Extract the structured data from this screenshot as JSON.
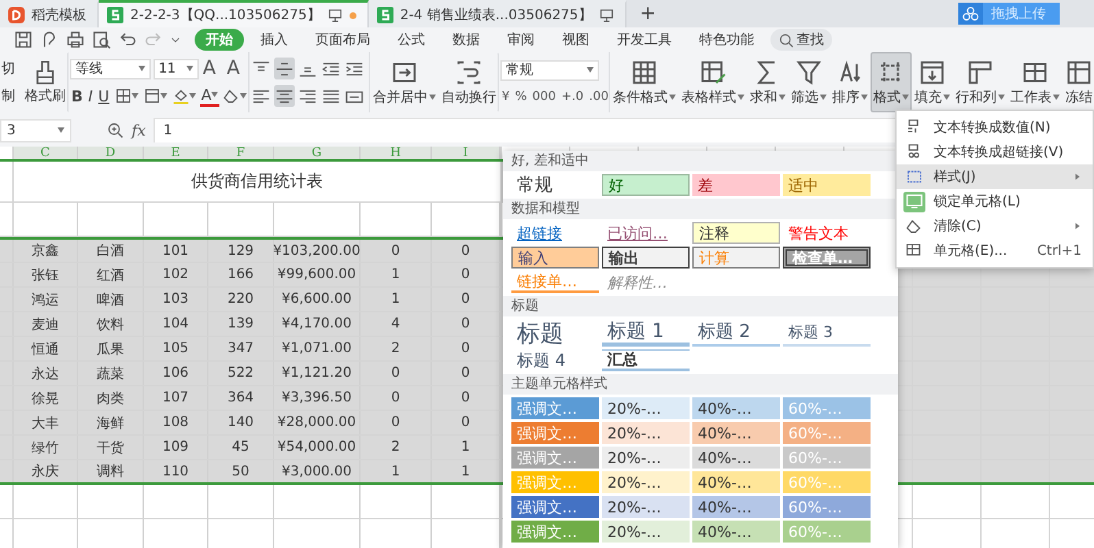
{
  "tabs": [
    {
      "label": "稻壳模板",
      "kind": "docer",
      "selected": false,
      "unsaved": false
    },
    {
      "label": "2-2-2-3【QQ...103506275】",
      "kind": "sheet",
      "selected": true,
      "unsaved": true
    },
    {
      "label": "2-4 销售业绩表...03506275】",
      "kind": "sheet",
      "selected": false,
      "unsaved": false
    }
  ],
  "new_tab": "+",
  "upload_button": "拖拽上传",
  "menu": [
    {
      "label": "开始",
      "selected": true
    },
    {
      "label": "插入",
      "selected": false
    },
    {
      "label": "页面布局",
      "selected": false
    },
    {
      "label": "公式",
      "selected": false
    },
    {
      "label": "数据",
      "selected": false
    },
    {
      "label": "审阅",
      "selected": false
    },
    {
      "label": "视图",
      "selected": false
    },
    {
      "label": "开发工具",
      "selected": false
    },
    {
      "label": "特色功能",
      "selected": false
    }
  ],
  "search_button": "查找",
  "ribbon": {
    "clipboard": {
      "cut": "切",
      "copy": "制",
      "format_painter": "格式刷"
    },
    "font": {
      "name": "等线",
      "size": "11",
      "grow": "A",
      "shrink": "A",
      "bold": "B",
      "italic": "I",
      "underline": "U",
      "font_color": "A"
    },
    "align_buttons": [
      {
        "kind": "top",
        "selected": false
      },
      {
        "kind": "middle",
        "selected": true
      },
      {
        "kind": "bottom",
        "selected": false
      },
      {
        "kind": "outdent",
        "selected": false
      },
      {
        "kind": "indent",
        "selected": false
      },
      {
        "kind": "left",
        "selected": false
      },
      {
        "kind": "center",
        "selected": true
      },
      {
        "kind": "right",
        "selected": false
      },
      {
        "kind": "justify",
        "selected": false
      },
      {
        "kind": "distributed",
        "selected": false
      }
    ],
    "merge": "合并居中",
    "wrap": "自动换行",
    "number_format": "常规",
    "number_buttons": [
      "¥",
      "%",
      "000",
      "+.0",
      ".00"
    ],
    "tools": [
      {
        "label": "条件格式",
        "kind": "conditional",
        "dropdown": true,
        "selected": false
      },
      {
        "label": "表格样式",
        "kind": "table",
        "dropdown": true,
        "selected": false
      },
      {
        "label": "求和",
        "kind": "sum",
        "dropdown": true,
        "selected": false
      },
      {
        "label": "筛选",
        "kind": "filter",
        "dropdown": true,
        "selected": false
      },
      {
        "label": "排序",
        "kind": "sort",
        "dropdown": true,
        "selected": false
      },
      {
        "label": "格式",
        "kind": "format",
        "dropdown": true,
        "selected": true
      },
      {
        "label": "填充",
        "kind": "fill",
        "dropdown": true,
        "selected": false
      },
      {
        "label": "行和列",
        "kind": "rowcol",
        "dropdown": true,
        "selected": false
      },
      {
        "label": "工作表",
        "kind": "sheet",
        "dropdown": true,
        "selected": false
      },
      {
        "label": "冻结",
        "kind": "freeze",
        "dropdown": false,
        "selected": false
      }
    ]
  },
  "formula_bar": {
    "cell": "3",
    "fx": "fx",
    "value": "1"
  },
  "sheet": {
    "columns": [
      {
        "label": "C",
        "selected": true
      },
      {
        "label": "D",
        "selected": true
      },
      {
        "label": "E",
        "selected": true
      },
      {
        "label": "F",
        "selected": true
      },
      {
        "label": "G",
        "selected": true
      },
      {
        "label": "H",
        "selected": true
      },
      {
        "label": "I",
        "selected": true
      }
    ],
    "title": "供货商信用统计表",
    "rows": [
      {
        "selected": true,
        "cells": [
          "京鑫",
          "白酒",
          "101",
          "129",
          "¥103,200.00",
          "0",
          "0"
        ]
      },
      {
        "selected": true,
        "cells": [
          "张钰",
          "红酒",
          "102",
          "166",
          "¥99,600.00",
          "1",
          "0"
        ]
      },
      {
        "selected": true,
        "cells": [
          "鸿运",
          "啤酒",
          "103",
          "220",
          "¥6,600.00",
          "1",
          "0"
        ]
      },
      {
        "selected": true,
        "cells": [
          "麦迪",
          "饮料",
          "104",
          "139",
          "¥4,170.00",
          "4",
          "0"
        ]
      },
      {
        "selected": true,
        "cells": [
          "恒通",
          "瓜果",
          "105",
          "347",
          "¥1,071.00",
          "2",
          "0"
        ]
      },
      {
        "selected": true,
        "cells": [
          "永达",
          "蔬菜",
          "106",
          "522",
          "¥1,121.20",
          "0",
          "0"
        ]
      },
      {
        "selected": true,
        "cells": [
          "徐晃",
          "肉类",
          "107",
          "364",
          "¥3,396.50",
          "0",
          "0"
        ]
      },
      {
        "selected": true,
        "cells": [
          "大丰",
          "海鲜",
          "108",
          "140",
          "¥28,000.00",
          "0",
          "0"
        ]
      },
      {
        "selected": true,
        "cells": [
          "绿竹",
          "干货",
          "109",
          "45",
          "¥54,000.00",
          "2",
          "1"
        ]
      },
      {
        "selected": true,
        "cells": [
          "永庆",
          "调料",
          "110",
          "50",
          "¥3,000.00",
          "1",
          "1"
        ]
      }
    ]
  },
  "style_gallery": {
    "sections": [
      {
        "title": "好, 差和适中",
        "items": [
          {
            "label": "常规",
            "kind": "normal"
          },
          {
            "label": "好",
            "kind": "good"
          },
          {
            "label": "差",
            "kind": "bad"
          },
          {
            "label": "适中",
            "kind": "neutral"
          }
        ]
      },
      {
        "title": "数据和模型",
        "items": [
          {
            "label": "超链接",
            "kind": "hyperlink"
          },
          {
            "label": "已访问…",
            "kind": "visited"
          },
          {
            "label": "注释",
            "kind": "note"
          },
          {
            "label": "警告文本",
            "kind": "warning"
          },
          {
            "label": "输入",
            "kind": "input"
          },
          {
            "label": "输出",
            "kind": "output"
          },
          {
            "label": "计算",
            "kind": "calc"
          },
          {
            "label": "检查单…",
            "kind": "check"
          },
          {
            "label": "链接单…",
            "kind": "linked"
          },
          {
            "label": "解释性…",
            "kind": "explanatory"
          }
        ]
      },
      {
        "title": "标题",
        "items": [
          {
            "label": "标题",
            "kind": "title"
          },
          {
            "label": "标题 1",
            "kind": "h1"
          },
          {
            "label": "标题 2",
            "kind": "h2"
          },
          {
            "label": "标题 3",
            "kind": "h3"
          },
          {
            "label": "标题 4",
            "kind": "h4"
          },
          {
            "label": "汇总",
            "kind": "total"
          }
        ]
      },
      {
        "title": "主题单元格样式",
        "items": [
          {
            "label": "强调文…",
            "kind": "accent",
            "color": "#5b9bd5"
          },
          {
            "label": "20%-…",
            "kind": "tint",
            "color": "#ddebf7"
          },
          {
            "label": "40%-…",
            "kind": "tint",
            "color": "#bdd7ee"
          },
          {
            "label": "60%-…",
            "kind": "accent",
            "color": "#9bc2e6"
          },
          {
            "label": "强调文…",
            "kind": "accent",
            "color": "#ed7d31"
          },
          {
            "label": "20%-…",
            "kind": "tint",
            "color": "#fce4d6"
          },
          {
            "label": "40%-…",
            "kind": "tint",
            "color": "#f8cbad"
          },
          {
            "label": "60%-…",
            "kind": "accent",
            "color": "#f4b084"
          },
          {
            "label": "强调文…",
            "kind": "accent",
            "color": "#a5a5a5"
          },
          {
            "label": "20%-…",
            "kind": "tint",
            "color": "#ededed"
          },
          {
            "label": "40%-…",
            "kind": "tint",
            "color": "#dbdbdb"
          },
          {
            "label": "60%-…",
            "kind": "accent",
            "color": "#c9c9c9"
          },
          {
            "label": "强调文…",
            "kind": "accent",
            "color": "#ffc000"
          },
          {
            "label": "20%-…",
            "kind": "tint",
            "color": "#fff2cc"
          },
          {
            "label": "40%-…",
            "kind": "tint",
            "color": "#ffe699"
          },
          {
            "label": "60%-…",
            "kind": "accent",
            "color": "#ffd966"
          },
          {
            "label": "强调文…",
            "kind": "accent",
            "color": "#4472c4"
          },
          {
            "label": "20%-…",
            "kind": "tint",
            "color": "#d9e1f2"
          },
          {
            "label": "40%-…",
            "kind": "tint",
            "color": "#b4c6e7"
          },
          {
            "label": "60%-…",
            "kind": "accent",
            "color": "#8ea9db"
          },
          {
            "label": "强调文…",
            "kind": "accent",
            "color": "#70ad47"
          },
          {
            "label": "20%-…",
            "kind": "tint",
            "color": "#e2efda"
          },
          {
            "label": "40%-…",
            "kind": "tint",
            "color": "#c6e0b4"
          },
          {
            "label": "60%-…",
            "kind": "accent",
            "color": "#a9d08e"
          }
        ]
      }
    ]
  },
  "context_menu": {
    "items": [
      {
        "label": "文本转换成数值(N)",
        "kind": "to-number",
        "submenu": false,
        "selected": false,
        "checked": false
      },
      {
        "label": "文本转换成超链接(V)",
        "kind": "to-link",
        "submenu": false,
        "selected": false,
        "checked": false
      },
      {
        "label": "样式(J)",
        "kind": "style",
        "submenu": true,
        "selected": true,
        "checked": false
      },
      {
        "label": "锁定单元格(L)",
        "kind": "lock",
        "submenu": false,
        "selected": false,
        "checked": true
      },
      {
        "label": "清除(C)",
        "kind": "clear",
        "submenu": true,
        "selected": false,
        "checked": false
      },
      {
        "label": "单元格(E)...",
        "kind": "cell",
        "submenu": false,
        "selected": false,
        "checked": false,
        "shortcut": "Ctrl+1"
      }
    ]
  }
}
